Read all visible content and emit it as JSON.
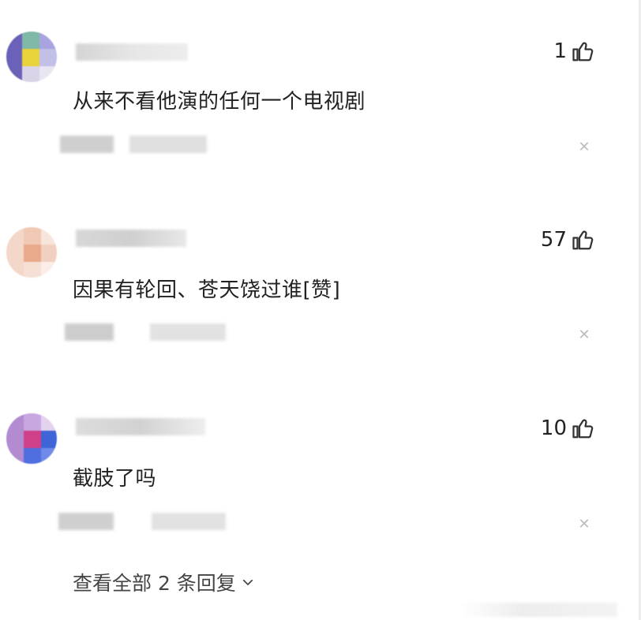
{
  "comments": [
    {
      "text": "从来不看他演的任何一个电视剧",
      "likes": "1"
    },
    {
      "text": "因果有轮回、苍天饶过谁[赞]",
      "likes": "57"
    },
    {
      "text": "截肢了吗",
      "likes": "10"
    }
  ],
  "view_all_label": "查看全部 2 条回复",
  "icons": {
    "like": "thumbs-up-icon",
    "close": "close-icon",
    "expand": "chevron-down-icon"
  },
  "colors": {
    "text": "#222222",
    "close": "#bdbdbd",
    "like_icon": "#333333"
  }
}
